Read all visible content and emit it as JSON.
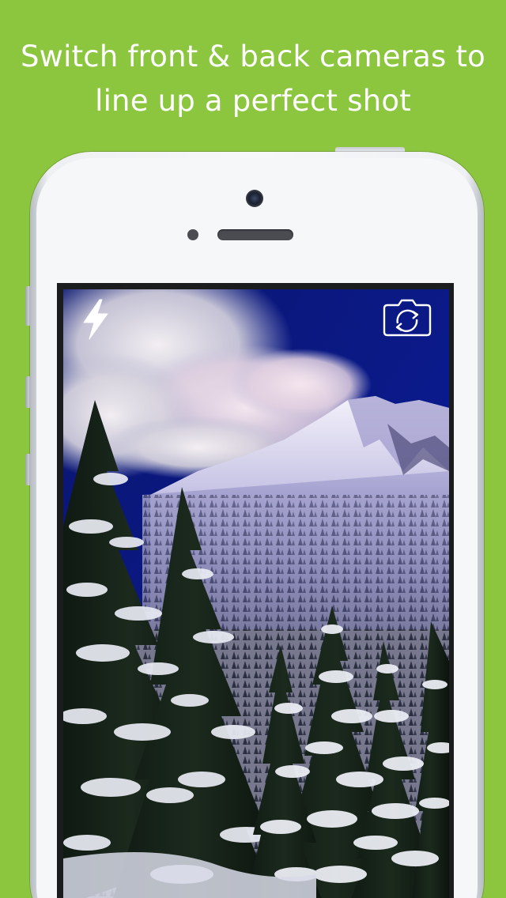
{
  "background_color": "#8cc63f",
  "headline": {
    "line1": "Switch front & back cameras to",
    "line2": "line up a perfect shot"
  },
  "camera_view": {
    "flash_icon": "lightning-bolt-icon",
    "switch_camera_icon": "camera-switch-icon",
    "preview": "snow-covered mountain and pine trees under a blue sky"
  }
}
